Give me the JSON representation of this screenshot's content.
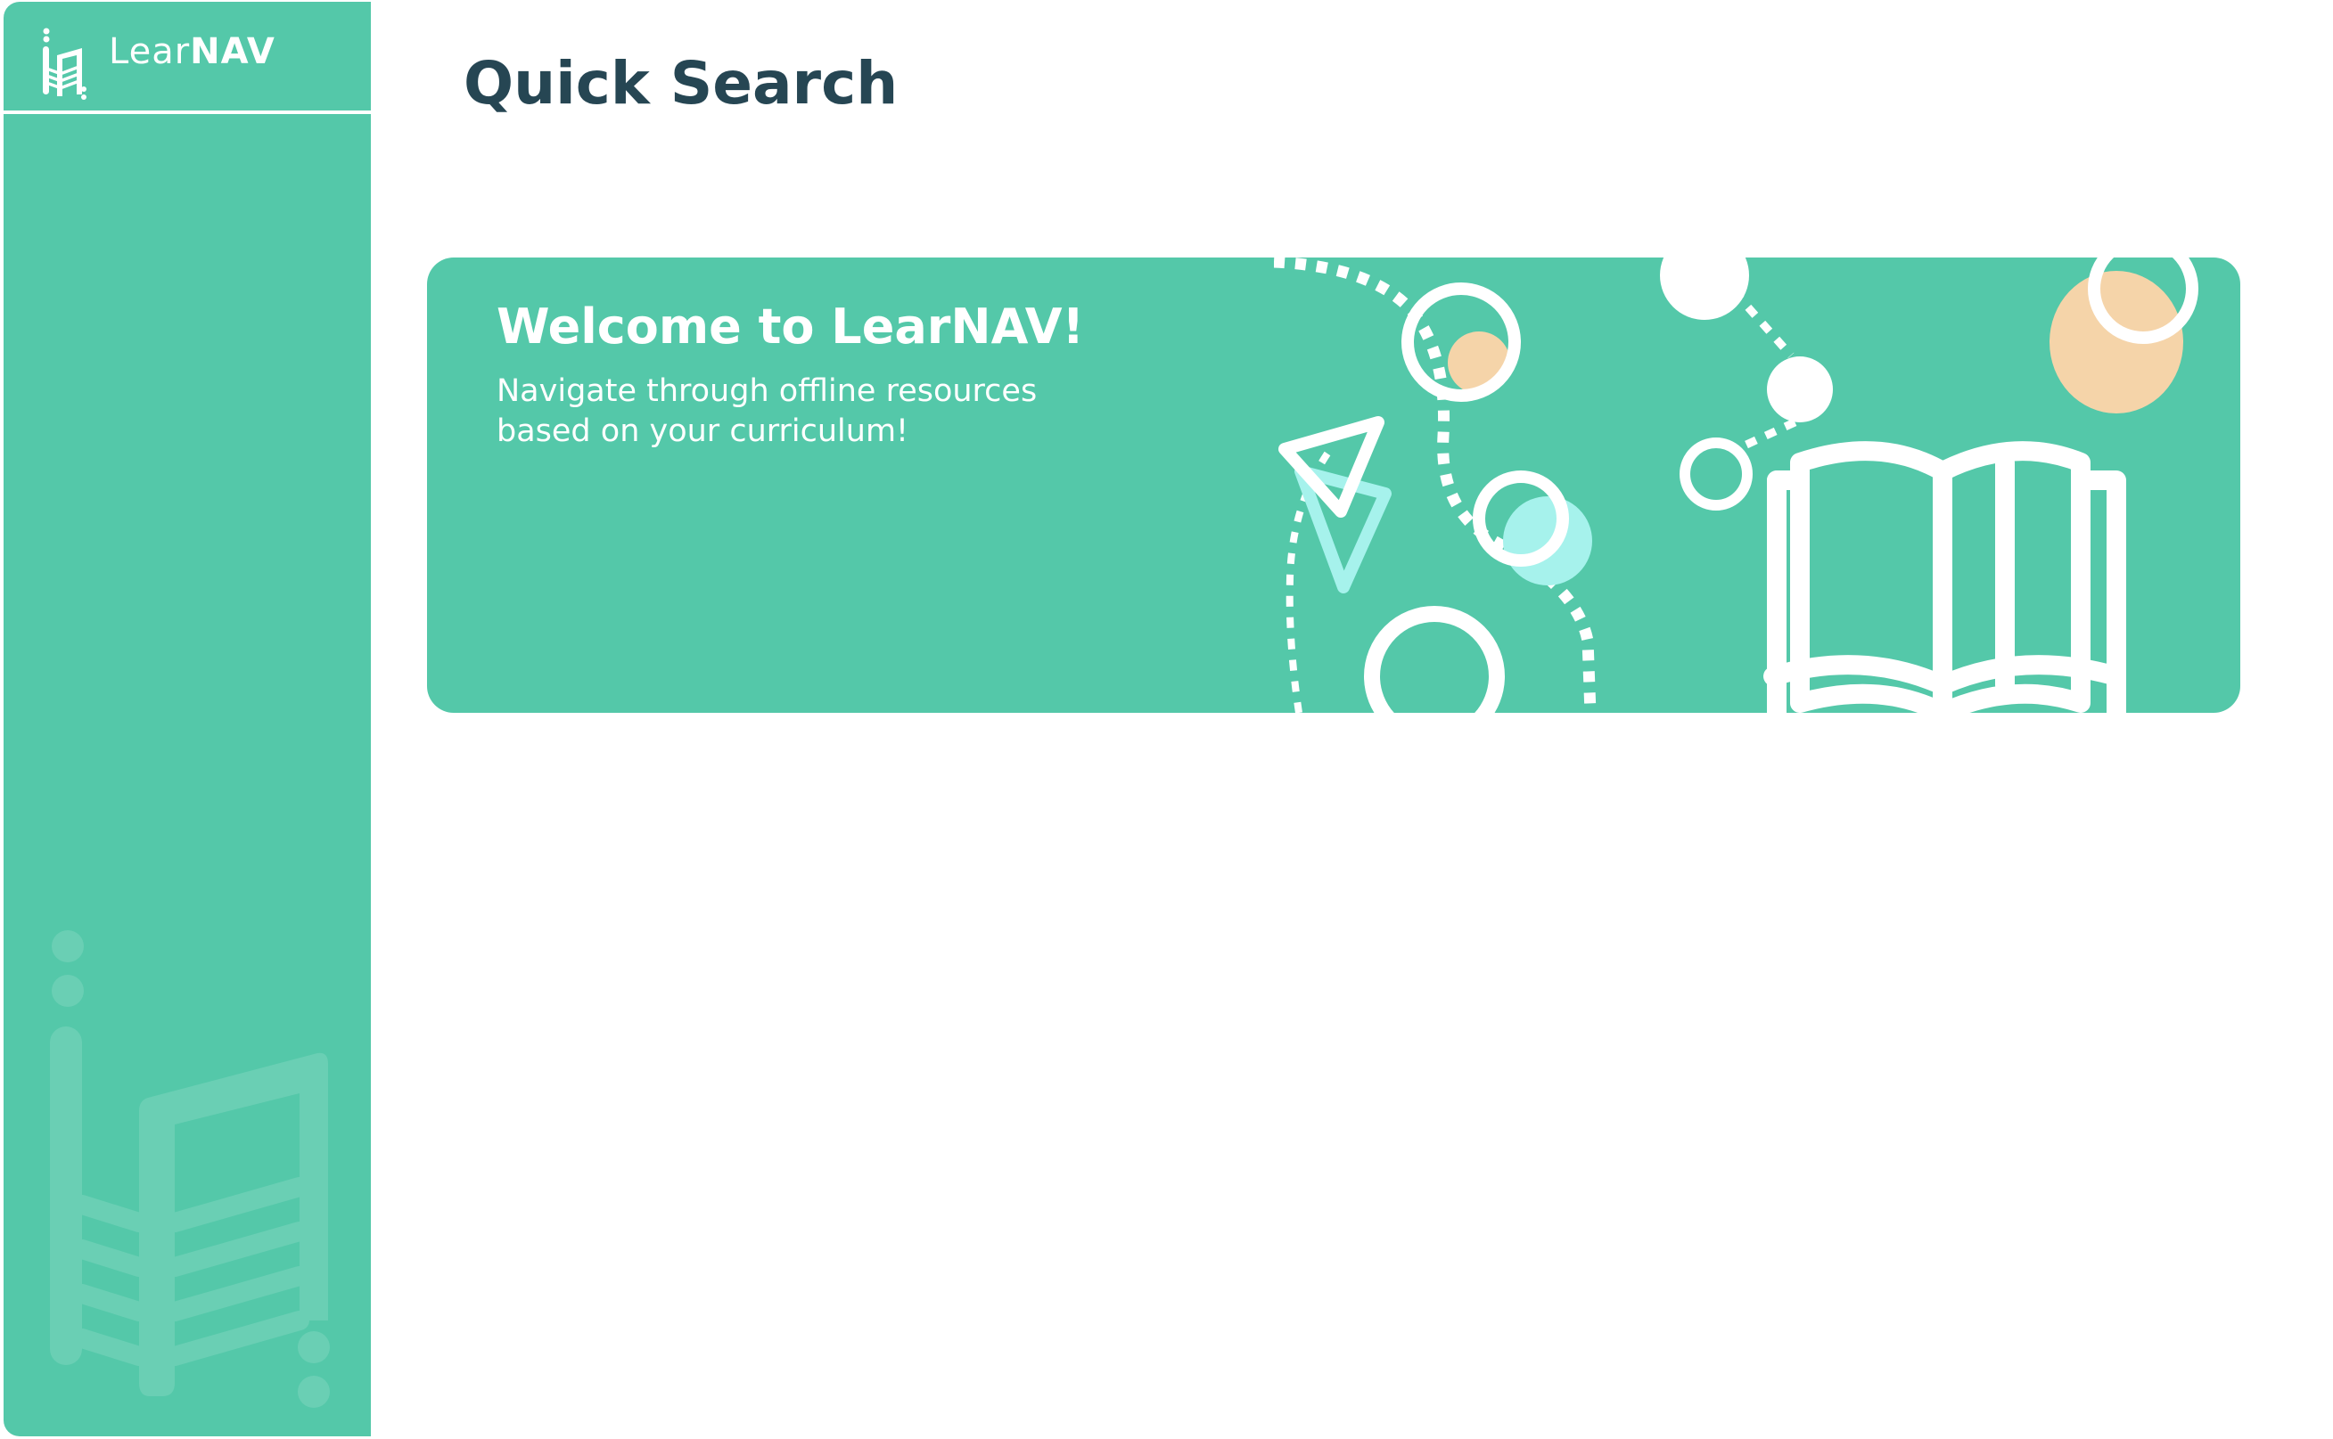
{
  "app": {
    "brand_light": "Lear",
    "brand_bold": "NAV"
  },
  "page": {
    "title": "Quick Search"
  },
  "banner": {
    "title": "Welcome to LearNAV!",
    "subtitle_line1": "Navigate through offline resources",
    "subtitle_line2": "based on your curriculum!"
  },
  "colors": {
    "sidebar_bg": "#54c8a9",
    "banner_bg": "#54c8a9",
    "title_text": "#264653",
    "accent_peach": "#f5d4a9",
    "accent_aqua": "#a6f2ec",
    "white": "#ffffff"
  },
  "icons": [
    "learnav-logo-icon",
    "book-icon",
    "triangle-icon",
    "circle-decor-icon"
  ]
}
